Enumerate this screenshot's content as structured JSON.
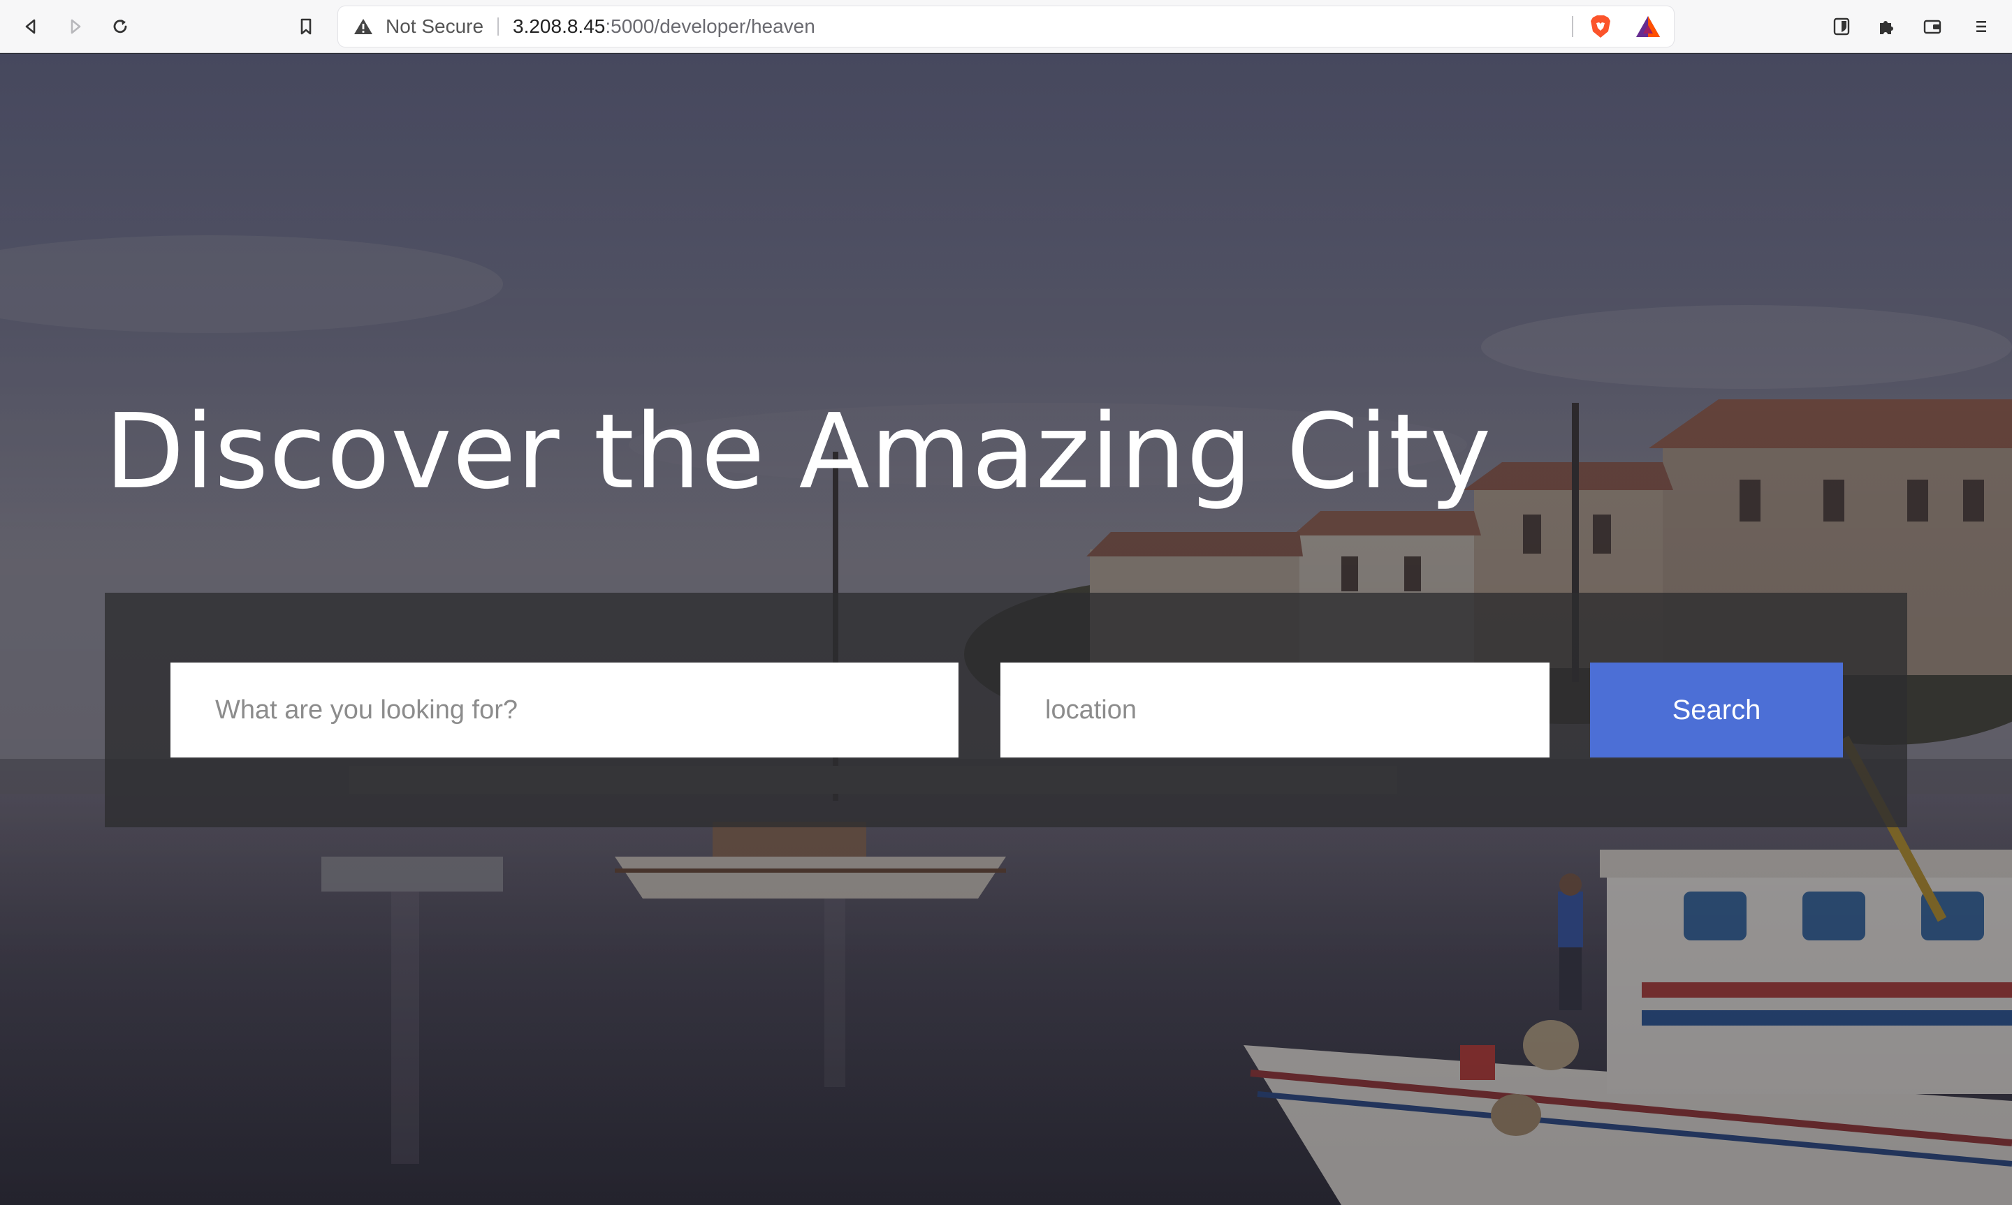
{
  "browser": {
    "security_label": "Not Secure",
    "url_host": "3.208.8.45",
    "url_rest": ":5000/developer/heaven",
    "icons": [
      "back-icon",
      "forward-icon",
      "reload-icon",
      "bookmark-icon",
      "warning-icon",
      "brave-shields-icon",
      "brave-rewards-icon",
      "bitwarden-icon",
      "extensions-icon",
      "wallet-icon",
      "menu-icon"
    ]
  },
  "hero": {
    "title": "Discover the Amazing City",
    "search": {
      "what_placeholder": "What are you looking for?",
      "location_placeholder": "location",
      "button_label": "Search"
    },
    "colors": {
      "button": "#4c6fd6",
      "panel": "#2d2d30"
    }
  }
}
